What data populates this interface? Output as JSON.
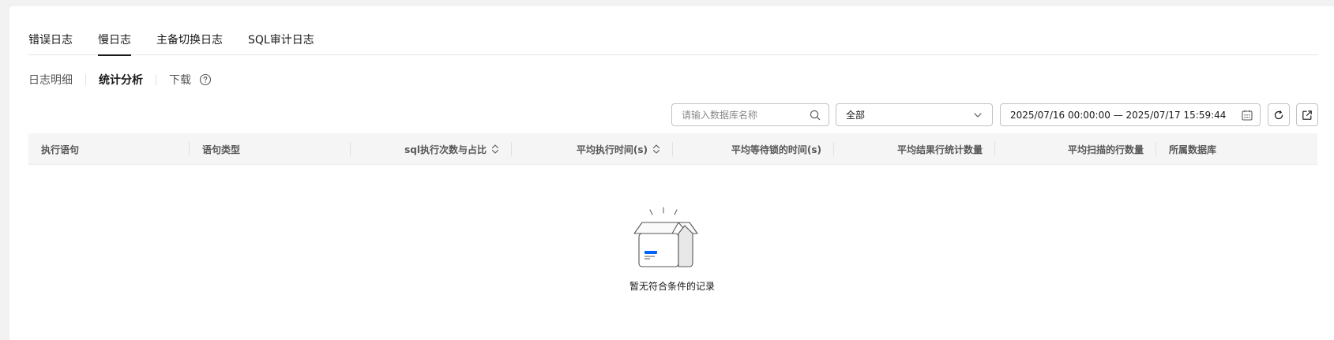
{
  "tabs": [
    {
      "label": "错误日志",
      "active": false
    },
    {
      "label": "慢日志",
      "active": true
    },
    {
      "label": "主备切换日志",
      "active": false
    },
    {
      "label": "SQL审计日志",
      "active": false
    }
  ],
  "subtabs": [
    {
      "label": "日志明细",
      "active": false
    },
    {
      "label": "统计分析",
      "active": true
    },
    {
      "label": "下载",
      "active": false
    }
  ],
  "search": {
    "placeholder": "请输入数据库名称",
    "value": ""
  },
  "filter_select": {
    "value": "全部"
  },
  "date_range": {
    "start": "2025/07/16 00:00:00",
    "separator": "—",
    "end": "2025/07/17 15:59:44"
  },
  "table": {
    "columns": [
      {
        "label": "执行语句",
        "sortable": false,
        "align": "left"
      },
      {
        "label": "语句类型",
        "sortable": false,
        "align": "left"
      },
      {
        "label": "sql执行次数与占比",
        "sortable": true,
        "align": "right"
      },
      {
        "label": "平均执行时间(s)",
        "sortable": true,
        "align": "right"
      },
      {
        "label": "平均等待锁的时间(s)",
        "sortable": false,
        "align": "right"
      },
      {
        "label": "平均结果行统计数量",
        "sortable": false,
        "align": "right"
      },
      {
        "label": "平均扫描的行数量",
        "sortable": false,
        "align": "right"
      },
      {
        "label": "所属数据库",
        "sortable": false,
        "align": "left"
      }
    ],
    "rows": [],
    "empty_text": "暂无符合条件的记录"
  },
  "colors": {
    "accent": "#0062ff",
    "border": "#c2c2c2",
    "header_bg": "#f5f5f5"
  }
}
